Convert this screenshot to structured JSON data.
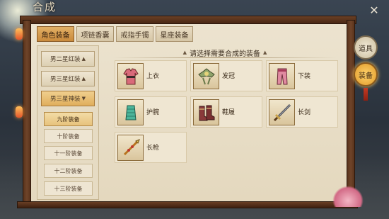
{
  "window": {
    "title": "合成",
    "close_glyph": "✕"
  },
  "tabs": [
    {
      "label": "角色装备",
      "active": true
    },
    {
      "label": "项链香囊",
      "active": false
    },
    {
      "label": "戒指手镯",
      "active": false
    },
    {
      "label": "星座装备",
      "active": false
    }
  ],
  "categories": [
    {
      "label": "男二星红装",
      "arrow": "▲",
      "open": false
    },
    {
      "label": "男三星红装",
      "arrow": "▲",
      "open": false
    },
    {
      "label": "男三星神装",
      "arrow": "▼",
      "open": true
    }
  ],
  "subcategories": [
    {
      "label": "九阶装备",
      "active": true
    },
    {
      "label": "十阶装备",
      "active": false
    },
    {
      "label": "十一阶装备",
      "active": false
    },
    {
      "label": "十二阶装备",
      "active": false
    },
    {
      "label": "十三阶装备",
      "active": false
    }
  ],
  "hint": {
    "text": "请选择需要合成的装备",
    "left_mark": "▲",
    "right_mark": "▲"
  },
  "items": [
    {
      "label": "上衣",
      "icon": "robe-icon"
    },
    {
      "label": "发冠",
      "icon": "crown-icon"
    },
    {
      "label": "下装",
      "icon": "trousers-icon"
    },
    {
      "label": "护腕",
      "icon": "bracer-icon"
    },
    {
      "label": "鞋履",
      "icon": "boots-icon"
    },
    {
      "label": "长剑",
      "icon": "sword-icon"
    },
    {
      "label": "长枪",
      "icon": "spear-icon"
    }
  ],
  "side_buttons": [
    {
      "label": "道具",
      "active": false
    },
    {
      "label": "装备",
      "active": true
    }
  ],
  "colors": {
    "accent": "#e0ae5c",
    "frame": "#5a331c",
    "parchment": "#ece3cf",
    "text": "#3d2d1c"
  }
}
